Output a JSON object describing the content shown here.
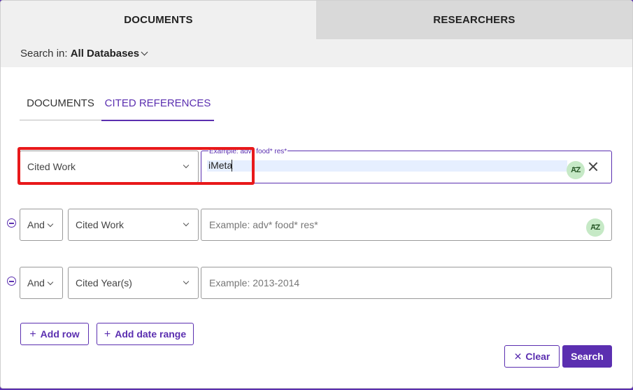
{
  "top_tabs": {
    "documents": "DOCUMENTS",
    "researchers": "RESEARCHERS"
  },
  "search_in": {
    "label": "Search in:",
    "value": "All Databases"
  },
  "sub_tabs": {
    "documents": "DOCUMENTS",
    "cited_references": "CITED REFERENCES"
  },
  "rows": [
    {
      "field": "Cited Work",
      "input_label": "Example: adv* food* res*",
      "value": "iMeta"
    },
    {
      "operator": "And",
      "field": "Cited Work",
      "placeholder": "Example: adv* food* res*"
    },
    {
      "operator": "And",
      "field": "Cited Year(s)",
      "placeholder": "Example: 2013-2014"
    }
  ],
  "icons": {
    "az": "AZ",
    "clear_field": "close-icon",
    "remove_row": "minus-circle-icon"
  },
  "buttons": {
    "add_row": "Add row",
    "add_date_range": "Add date range",
    "clear": "Clear",
    "search": "Search"
  },
  "colors": {
    "accent": "#5b2fb0",
    "highlight": "#e8191b",
    "az_bg": "#c6e9c6"
  }
}
